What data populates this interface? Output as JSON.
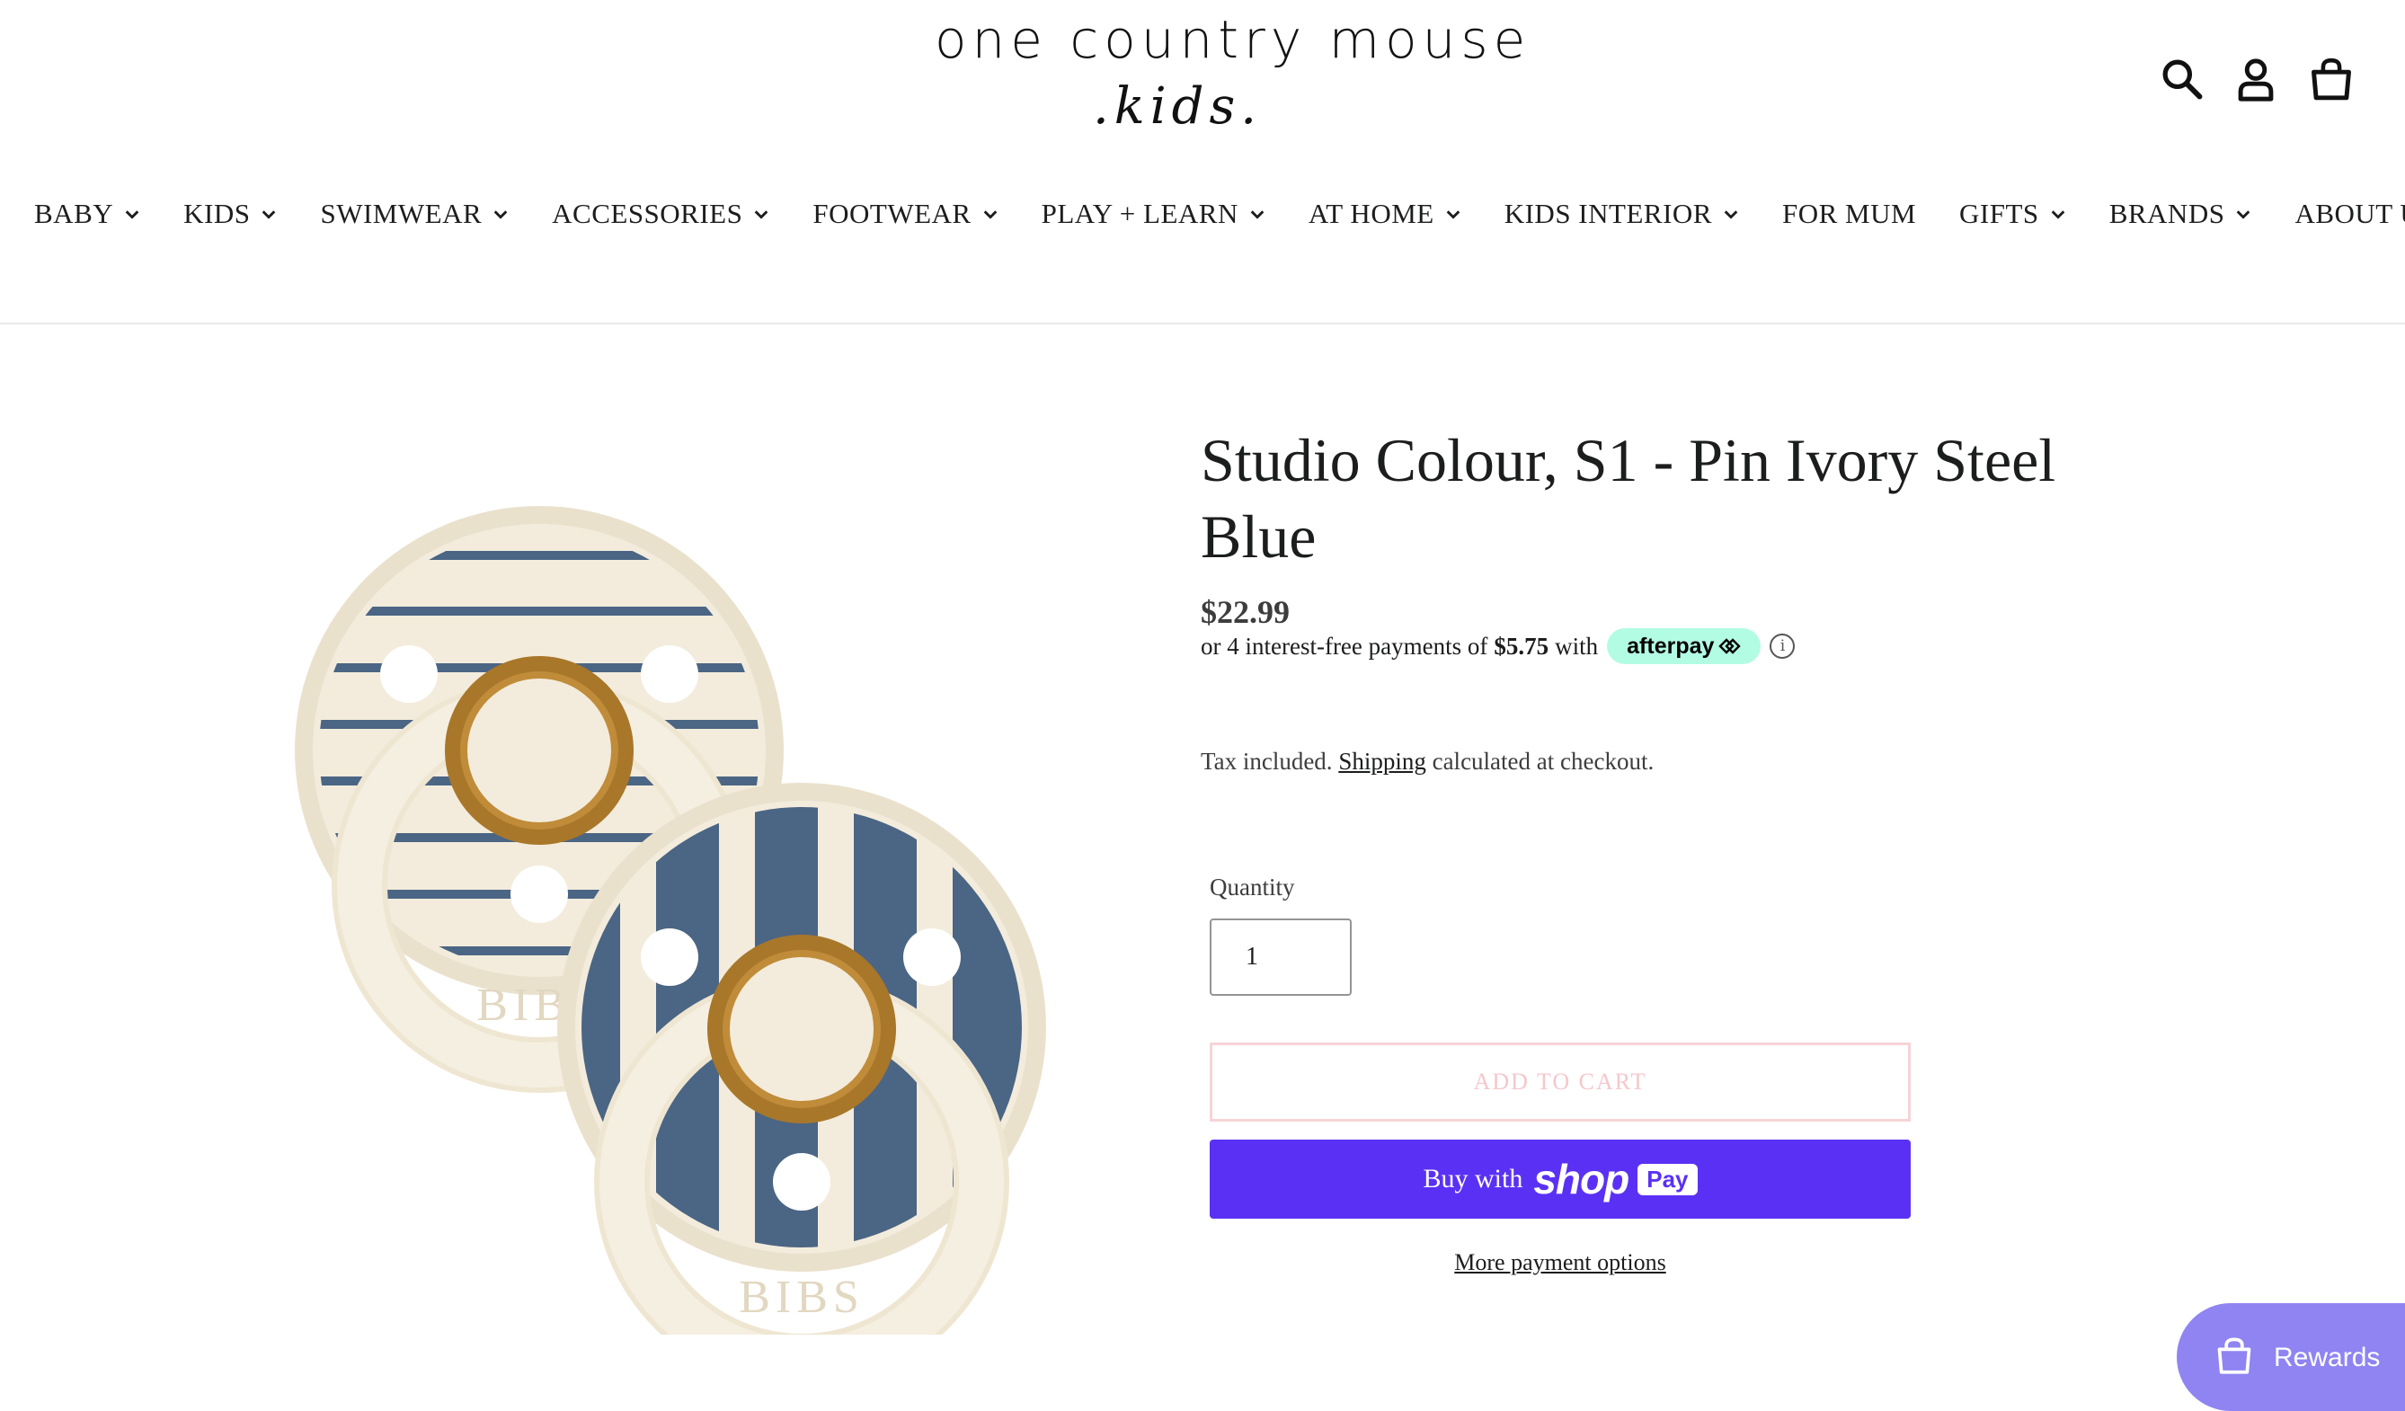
{
  "logo": {
    "line1": "one country mouse",
    "line2": ".kids."
  },
  "header_icons": [
    "search-icon",
    "account-icon",
    "cart-icon"
  ],
  "nav": {
    "items": [
      {
        "label": "BABY",
        "has_dropdown": true
      },
      {
        "label": "KIDS",
        "has_dropdown": true
      },
      {
        "label": "SWIMWEAR",
        "has_dropdown": true
      },
      {
        "label": "ACCESSORIES",
        "has_dropdown": true
      },
      {
        "label": "FOOTWEAR",
        "has_dropdown": true
      },
      {
        "label": "PLAY + LEARN",
        "has_dropdown": true
      },
      {
        "label": "AT HOME",
        "has_dropdown": true
      },
      {
        "label": "KIDS INTERIOR",
        "has_dropdown": true
      },
      {
        "label": "FOR MUM",
        "has_dropdown": false
      },
      {
        "label": "GIFTS",
        "has_dropdown": true
      },
      {
        "label": "BRANDS",
        "has_dropdown": true
      },
      {
        "label": "ABOUT US",
        "has_dropdown": false
      }
    ]
  },
  "product": {
    "title": "Studio Colour, S1 - Pin Ivory Steel Blue",
    "price": "$22.99",
    "afterpay": {
      "prefix": "or 4 interest-free payments of",
      "amount": "$5.75",
      "suffix": "with",
      "badge": "afterpay",
      "info_icon": "ⓘ"
    },
    "tax": {
      "prefix": "Tax included.",
      "link": "Shipping",
      "suffix": "calculated at checkout."
    },
    "quantity": {
      "label": "Quantity",
      "value": "1"
    },
    "add_to_cart": "ADD TO CART",
    "shop_pay": {
      "buy_with": "Buy with",
      "shop": "shop",
      "pay": "Pay"
    },
    "more_options": "More payment options",
    "image": {
      "brand_mark": "BIBS"
    }
  },
  "rewards": {
    "label": "Rewards"
  },
  "colors": {
    "text": "#1c1d1d",
    "shop_pay": "#5a31f4",
    "afterpay_badge": "#b2fce4",
    "add_to_cart_border": "#f6d4d7",
    "rewards": "#8f84f2",
    "pacifier_ivory": "#f3ecdc",
    "pacifier_blue": "#4b6584",
    "pacifier_teat": "#b7832a"
  }
}
